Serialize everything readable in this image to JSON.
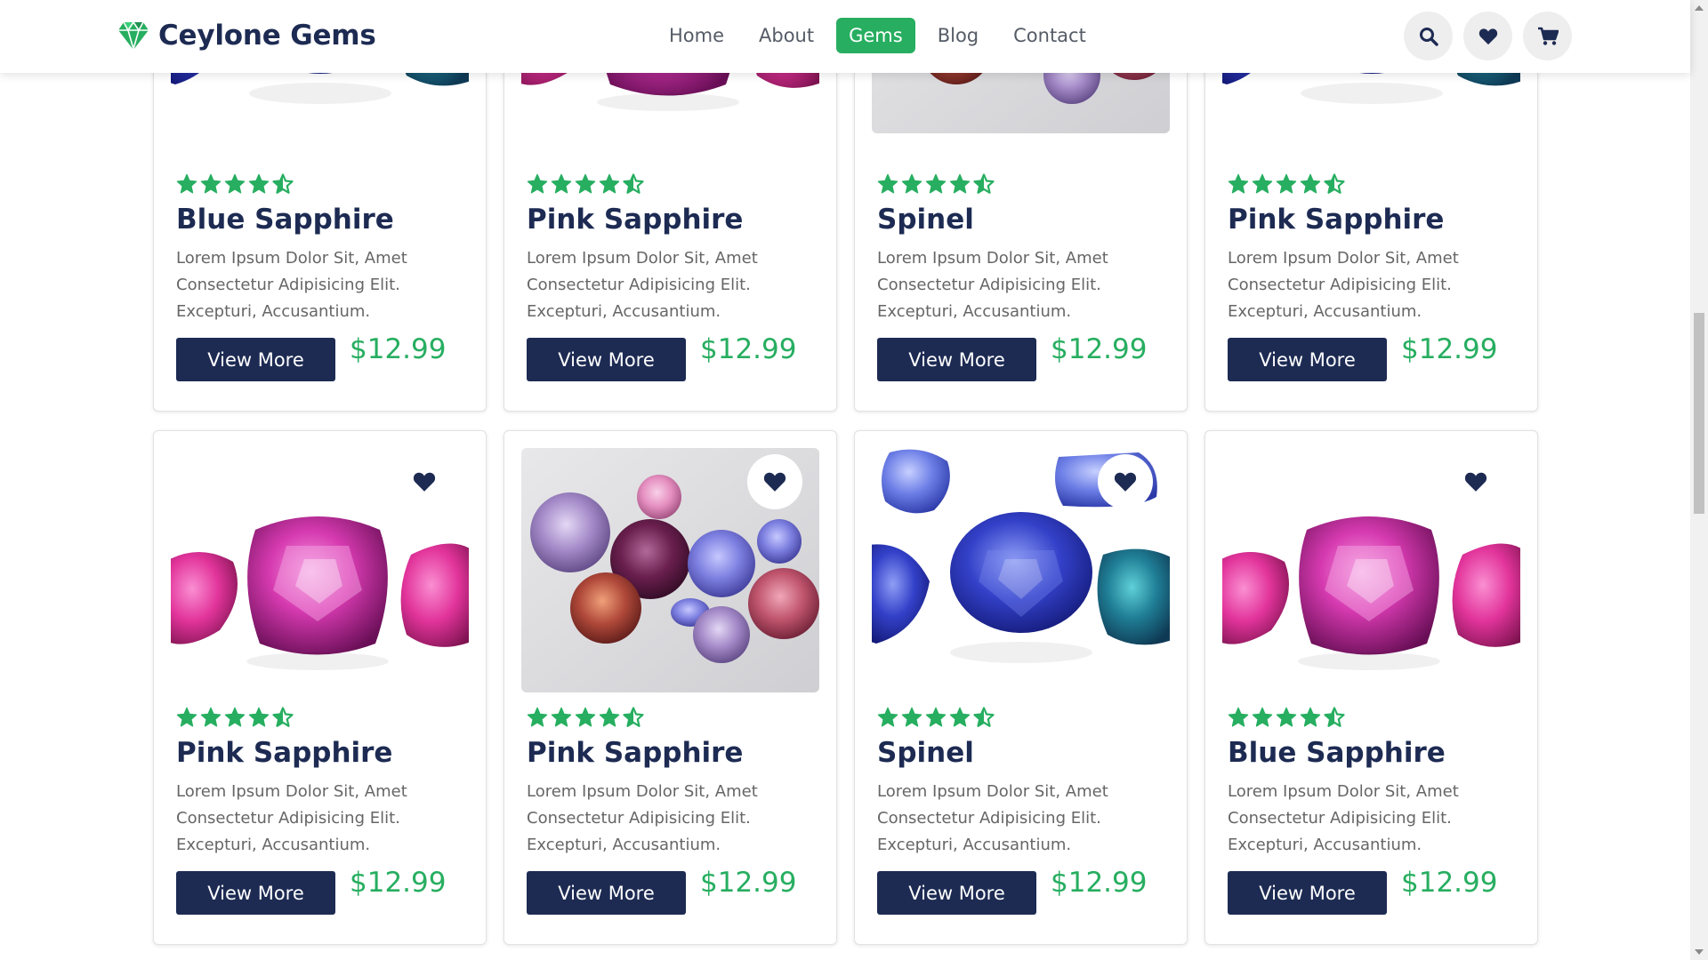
{
  "brand": {
    "name": "Ceylone Gems",
    "logo_icon": "gem-icon",
    "accent_color": "#27ae60",
    "navy_color": "#1d2b53"
  },
  "nav": {
    "items": [
      {
        "label": "Home",
        "active": false
      },
      {
        "label": "About",
        "active": false
      },
      {
        "label": "Gems",
        "active": true
      },
      {
        "label": "Blog",
        "active": false
      },
      {
        "label": "Contact",
        "active": false
      }
    ]
  },
  "actions": [
    {
      "icon": "search-icon"
    },
    {
      "icon": "heart-icon"
    },
    {
      "icon": "cart-icon"
    }
  ],
  "products": [
    {
      "name": "Blue Sapphire",
      "rating": 4.5,
      "desc": [
        "Lorem Ipsum Dolor Sit, Amet",
        "Consectetur Adipisicing Elit.",
        "Excepturi, Accusantium."
      ],
      "button": "View More",
      "price": "$12.99",
      "image": "blue-sapphire-image"
    },
    {
      "name": "Pink Sapphire",
      "rating": 4.5,
      "desc": [
        "Lorem Ipsum Dolor Sit, Amet",
        "Consectetur Adipisicing Elit.",
        "Excepturi, Accusantium."
      ],
      "button": "View More",
      "price": "$12.99",
      "image": "pink-sapphire-image"
    },
    {
      "name": "Spinel",
      "rating": 4.5,
      "desc": [
        "Lorem Ipsum Dolor Sit, Amet",
        "Consectetur Adipisicing Elit.",
        "Excepturi, Accusantium."
      ],
      "button": "View More",
      "price": "$12.99",
      "image": "spinel-image"
    },
    {
      "name": "Pink Sapphire",
      "rating": 4.5,
      "desc": [
        "Lorem Ipsum Dolor Sit, Amet",
        "Consectetur Adipisicing Elit.",
        "Excepturi, Accusantium."
      ],
      "button": "View More",
      "price": "$12.99",
      "image": "blue-sapphire-image"
    },
    {
      "name": "Pink Sapphire",
      "rating": 4.5,
      "desc": [
        "Lorem Ipsum Dolor Sit, Amet",
        "Consectetur Adipisicing Elit.",
        "Excepturi, Accusantium."
      ],
      "button": "View More",
      "price": "$12.99",
      "image": "pink-sapphire-image",
      "fav_icon": "heart-icon"
    },
    {
      "name": "Pink Sapphire",
      "rating": 4.5,
      "desc": [
        "Lorem Ipsum Dolor Sit, Amet",
        "Consectetur Adipisicing Elit.",
        "Excepturi, Accusantium."
      ],
      "button": "View More",
      "price": "$12.99",
      "image": "spinel-image",
      "fav_icon": "heart-icon"
    },
    {
      "name": "Spinel",
      "rating": 4.5,
      "desc": [
        "Lorem Ipsum Dolor Sit, Amet",
        "Consectetur Adipisicing Elit.",
        "Excepturi, Accusantium."
      ],
      "button": "View More",
      "price": "$12.99",
      "image": "blue-sapphire-image",
      "fav_icon": "heart-icon"
    },
    {
      "name": "Blue Sapphire",
      "rating": 4.5,
      "desc": [
        "Lorem Ipsum Dolor Sit, Amet",
        "Consectetur Adipisicing Elit.",
        "Excepturi, Accusantium."
      ],
      "button": "View More",
      "price": "$12.99",
      "image": "pink-sapphire-image",
      "fav_icon": "heart-icon"
    }
  ]
}
